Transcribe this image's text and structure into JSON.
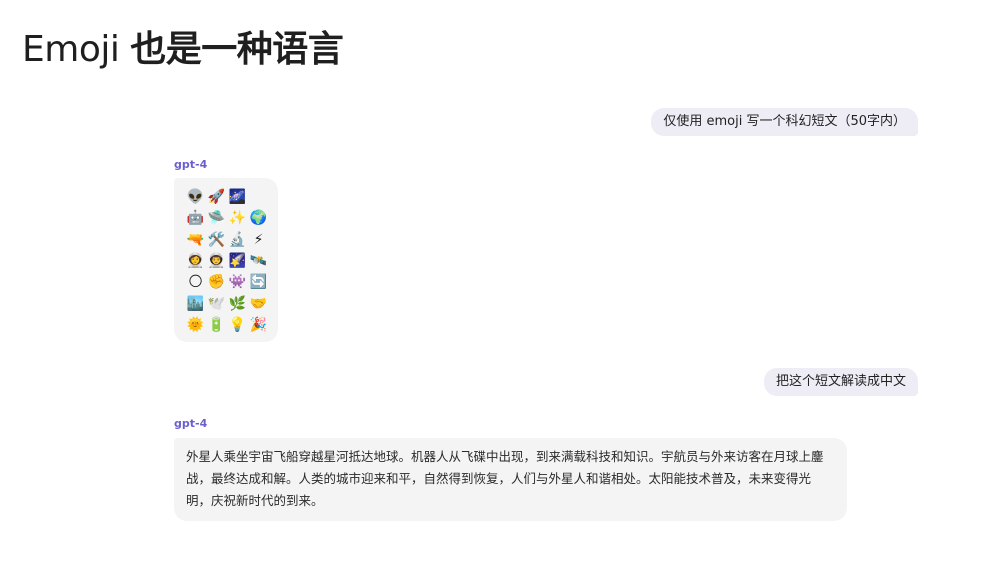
{
  "title": {
    "prefix": "Emoji",
    "main": "也是一种语言"
  },
  "chat": {
    "user_message_1": "仅使用 emoji 写一个科幻短文（50字内）",
    "model_label_1": "gpt-4",
    "emoji_rows": [
      [
        "👽",
        "🚀",
        "🌌"
      ],
      [
        "🤖",
        "🛸",
        "✨",
        "🌍"
      ],
      [
        "🔫",
        "🛠️",
        "🔬",
        "⚡"
      ],
      [
        "👩‍🚀",
        "👨‍🚀",
        "🌠",
        "🛰️"
      ],
      [
        "🌕",
        "✊",
        "👾",
        "🔄"
      ],
      [
        "🏙️",
        "🕊️",
        "🌿",
        "🤝"
      ],
      [
        "🌞",
        "🔋",
        "💡",
        "🎉"
      ]
    ],
    "user_message_2": "把这个短文解读成中文",
    "model_label_2": "gpt-4",
    "reply_2": "外星人乘坐宇宙飞船穿越星河抵达地球。机器人从飞碟中出现，到来满载科技和知识。宇航员与外来访客在月球上鏖战，最终达成和解。人类的城市迎来和平，自然得到恢复，人们与外星人和谐相处。太阳能技术普及，未来变得光明，庆祝新时代的到来。"
  }
}
